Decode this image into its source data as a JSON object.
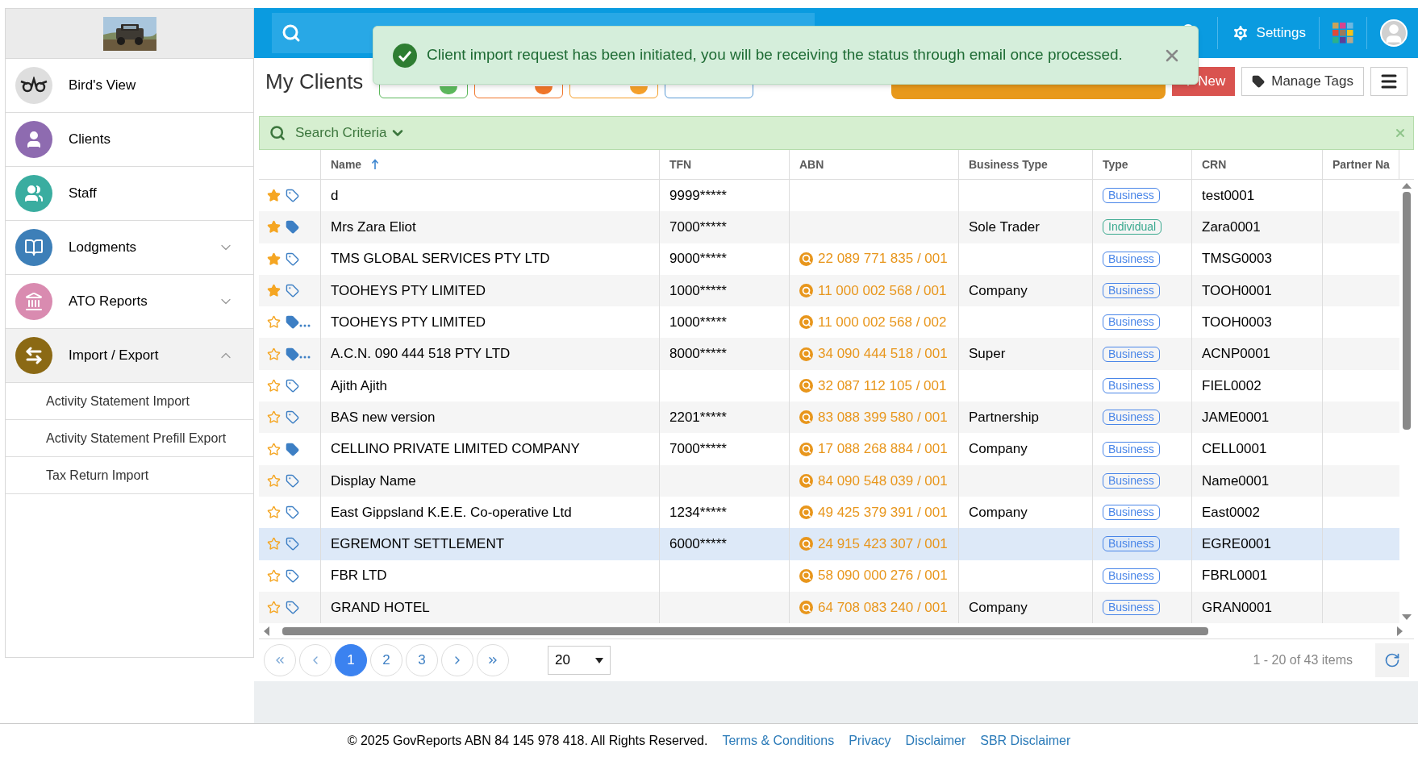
{
  "sidebar": {
    "items": [
      {
        "label": "Bird's View"
      },
      {
        "label": "Clients"
      },
      {
        "label": "Staff"
      },
      {
        "label": "Lodgments",
        "expanded": false
      },
      {
        "label": "ATO Reports",
        "expanded": false
      },
      {
        "label": "Import / Export",
        "expanded": true,
        "children": [
          {
            "label": "Activity Statement Import"
          },
          {
            "label": "Activity Statement Prefill Export"
          },
          {
            "label": "Tax Return Import"
          }
        ]
      }
    ]
  },
  "header": {
    "settings_label": "Settings"
  },
  "toast": {
    "message": "Client import request has been initiated, you will be receiving the status through email once processed."
  },
  "page": {
    "title": "My Clients",
    "tabs": [
      {
        "kind": "count",
        "color": "#5cb85c"
      },
      {
        "kind": "count",
        "color": "#f0762a"
      },
      {
        "kind": "count",
        "color": "#f5a02a"
      },
      {
        "kind": "tag",
        "color": "#5b9bd5"
      }
    ],
    "new_button": "New",
    "manage_tags_button": "Manage Tags"
  },
  "search_criteria": {
    "label": "Search Criteria"
  },
  "table": {
    "columns": [
      {
        "label": "Name",
        "sorted": true
      },
      {
        "label": "TFN"
      },
      {
        "label": "ABN"
      },
      {
        "label": "Business Type"
      },
      {
        "label": "Type"
      },
      {
        "label": "CRN"
      },
      {
        "label": "Partner Na"
      }
    ],
    "rows": [
      {
        "starred": true,
        "tagged": false,
        "more_tags": false,
        "selected": false,
        "name": "d",
        "tfn": "9999*****",
        "type": {
          "label": "Business",
          "kind": "business"
        },
        "crn": "test0001"
      },
      {
        "starred": true,
        "tagged": true,
        "more_tags": false,
        "selected": false,
        "name": "Mrs Zara Eliot",
        "tfn": "7000*****",
        "business_type": "Sole Trader",
        "type": {
          "label": "Individual",
          "kind": "individual"
        },
        "crn": "Zara0001"
      },
      {
        "starred": true,
        "tagged": false,
        "more_tags": false,
        "selected": false,
        "name": "TMS GLOBAL SERVICES PTY LTD",
        "tfn": "9000*****",
        "abn": "22 089 771 835 / 001",
        "type": {
          "label": "Business",
          "kind": "business"
        },
        "crn": "TMSG0003"
      },
      {
        "starred": true,
        "tagged": false,
        "more_tags": false,
        "selected": false,
        "name": "TOOHEYS PTY LIMITED",
        "tfn": "1000*****",
        "abn": "11 000 002 568 / 001",
        "business_type": "Company",
        "type": {
          "label": "Business",
          "kind": "business"
        },
        "crn": "TOOH0001"
      },
      {
        "starred": false,
        "tagged": true,
        "more_tags": true,
        "selected": false,
        "name": "TOOHEYS PTY LIMITED",
        "tfn": "1000*****",
        "abn": "11 000 002 568 / 002",
        "type": {
          "label": "Business",
          "kind": "business"
        },
        "crn": "TOOH0003"
      },
      {
        "starred": false,
        "tagged": true,
        "more_tags": true,
        "selected": false,
        "name": "A.C.N. 090 444 518 PTY LTD",
        "tfn": "8000*****",
        "abn": "34 090 444 518 / 001",
        "business_type": "Super",
        "type": {
          "label": "Business",
          "kind": "business"
        },
        "crn": "ACNP0001"
      },
      {
        "starred": false,
        "tagged": false,
        "more_tags": false,
        "selected": false,
        "name": "Ajith Ajith",
        "abn": "32 087 112 105 / 001",
        "type": {
          "label": "Business",
          "kind": "business"
        },
        "crn": "FIEL0002"
      },
      {
        "starred": false,
        "tagged": false,
        "more_tags": false,
        "selected": false,
        "name": "BAS new version",
        "tfn": "2201*****",
        "abn": "83 088 399 580 / 001",
        "business_type": "Partnership",
        "type": {
          "label": "Business",
          "kind": "business"
        },
        "crn": "JAME0001"
      },
      {
        "starred": false,
        "tagged": true,
        "more_tags": false,
        "selected": false,
        "name": "CELLINO PRIVATE LIMITED COMPANY",
        "tfn": "7000*****",
        "abn": "17 088 268 884 / 001",
        "business_type": "Company",
        "type": {
          "label": "Business",
          "kind": "business"
        },
        "crn": "CELL0001"
      },
      {
        "starred": false,
        "tagged": false,
        "more_tags": false,
        "selected": false,
        "name": "Display Name",
        "abn": "84 090 548 039 / 001",
        "type": {
          "label": "Business",
          "kind": "business"
        },
        "crn": "Name0001"
      },
      {
        "starred": false,
        "tagged": false,
        "more_tags": false,
        "selected": false,
        "name": "East Gippsland K.E.E. Co-operative Ltd",
        "tfn": "1234*****",
        "abn": "49 425 379 391 / 001",
        "business_type": "Company",
        "type": {
          "label": "Business",
          "kind": "business"
        },
        "crn": "East0002"
      },
      {
        "starred": false,
        "tagged": false,
        "more_tags": false,
        "selected": true,
        "name": "EGREMONT SETTLEMENT",
        "tfn": "6000*****",
        "abn": "24 915 423 307 / 001",
        "type": {
          "label": "Business",
          "kind": "business"
        },
        "crn": "EGRE0001"
      },
      {
        "starred": false,
        "tagged": false,
        "more_tags": false,
        "selected": false,
        "name": "FBR LTD",
        "abn": "58 090 000 276 / 001",
        "type": {
          "label": "Business",
          "kind": "business"
        },
        "crn": "FBRL0001"
      },
      {
        "starred": false,
        "tagged": false,
        "more_tags": false,
        "selected": false,
        "name": "GRAND HOTEL",
        "abn": "64 708 083 240 / 001",
        "business_type": "Company",
        "type": {
          "label": "Business",
          "kind": "business"
        },
        "crn": "GRAN0001"
      }
    ]
  },
  "pagination": {
    "pages": [
      {
        "label": "1",
        "selected": true
      },
      {
        "label": "2",
        "selected": false
      },
      {
        "label": "3",
        "selected": false
      }
    ],
    "page_size": "20",
    "summary": "1 - 20 of 43 items"
  },
  "footer": {
    "copyright": "© 2025 GovReports ABN 84 145 978 418. All Rights Reserved.",
    "links": [
      "Terms & Conditions",
      "Privacy",
      "Disclaimer",
      "SBR Disclaimer"
    ]
  }
}
